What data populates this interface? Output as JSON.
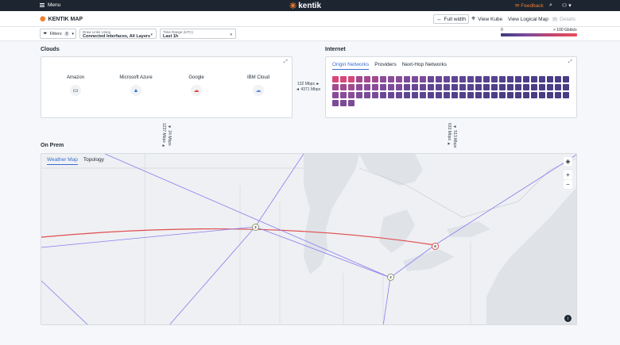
{
  "topbar": {
    "menu_label": "Menu",
    "brand": "kentik",
    "feedback_label": "Feedback",
    "search_icon": "search-icon",
    "user_icon": "user-icon"
  },
  "header": {
    "title": "KENTIK MAP",
    "full_width_label": "Full width",
    "view_kube_label": "View Kube",
    "view_logical_map_label": "View Logical Map",
    "details_label": "Details"
  },
  "filters": {
    "filters_label": "Filters",
    "filters_count": "0",
    "draw_links": {
      "label": "Draw Links Using",
      "value": "Connected Interfaces, All Layers"
    },
    "time_range": {
      "label": "Time Range (UTC)",
      "value": "Last 1h"
    },
    "legend_min": "0",
    "legend_max": "> 100 Gbits/s"
  },
  "clouds": {
    "title": "Clouds",
    "providers": [
      {
        "name": "Amazon",
        "icon": "aws-icon"
      },
      {
        "name": "Microsoft Azure",
        "icon": "azure-icon"
      },
      {
        "name": "Google",
        "icon": "gcp-icon"
      },
      {
        "name": "IBM Cloud",
        "icon": "ibm-cloud-icon"
      }
    ]
  },
  "links": {
    "cloud_to_internet_out": "132 Mbps ►",
    "cloud_to_internet_in": "◄ 4371 Mbps",
    "clouds_to_onprem_a": "1237 Mbps ►",
    "clouds_to_onprem_b": "◄ 24 Mbps",
    "internet_to_onprem_a": "633 Mbps ►",
    "internet_to_onprem_b": "◄ 513 Mbps"
  },
  "internet": {
    "title": "Internet",
    "tabs": [
      "Origin Networks",
      "Providers",
      "Next-Hop Networks"
    ],
    "active_tab": 0,
    "cell_colors": [
      "#d6487a",
      "#a24a8e",
      "#8a4c98",
      "#7c4b98",
      "#6a4696",
      "#5e4592",
      "#574290",
      "#51408c",
      "#4d3e89",
      "#4a3d86"
    ]
  },
  "onprem": {
    "title": "On Prem",
    "tabs": [
      "Weather Map",
      "Topology"
    ],
    "active_tab": 0,
    "nodes": [
      {
        "label": "2",
        "id": "node-midwest"
      },
      {
        "label": "6",
        "id": "node-east"
      },
      {
        "label": "2",
        "id": "node-south"
      }
    ]
  }
}
